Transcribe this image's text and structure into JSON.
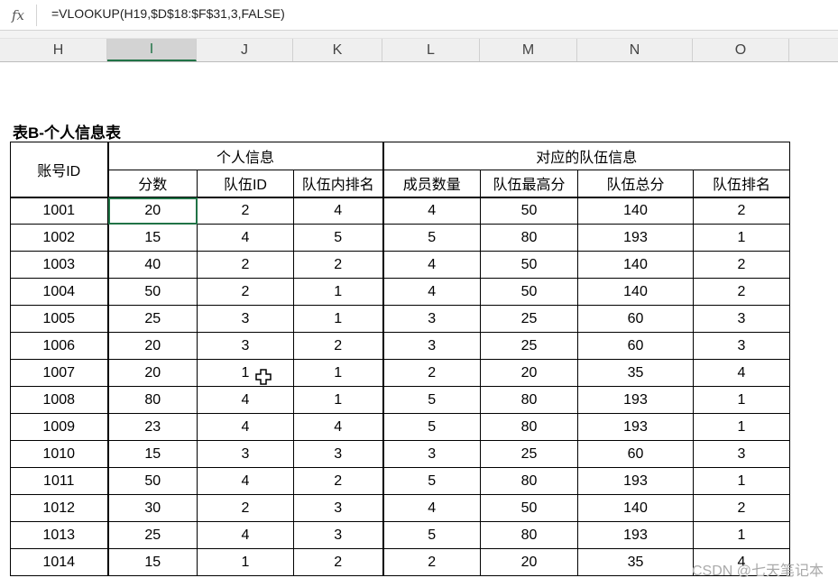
{
  "formula_bar": {
    "fx_label": "fx",
    "formula": "=VLOOKUP(H19,$D$18:$F$31,3,FALSE)"
  },
  "columns": [
    "H",
    "I",
    "J",
    "K",
    "L",
    "M",
    "N",
    "O"
  ],
  "selected_column": "I",
  "table": {
    "title": "表B-个人信息表",
    "group_headers": {
      "account": "账号ID",
      "personal": "个人信息",
      "team": "对应的队伍信息"
    },
    "sub_headers": [
      "分数",
      "队伍ID",
      "队伍内排名",
      "成员数量",
      "队伍最高分",
      "队伍总分",
      "队伍排名"
    ],
    "rows": [
      [
        "1001",
        "20",
        "2",
        "4",
        "4",
        "50",
        "140",
        "2"
      ],
      [
        "1002",
        "15",
        "4",
        "5",
        "5",
        "80",
        "193",
        "1"
      ],
      [
        "1003",
        "40",
        "2",
        "2",
        "4",
        "50",
        "140",
        "2"
      ],
      [
        "1004",
        "50",
        "2",
        "1",
        "4",
        "50",
        "140",
        "2"
      ],
      [
        "1005",
        "25",
        "3",
        "1",
        "3",
        "25",
        "60",
        "3"
      ],
      [
        "1006",
        "20",
        "3",
        "2",
        "3",
        "25",
        "60",
        "3"
      ],
      [
        "1007",
        "20",
        "1",
        "1",
        "2",
        "20",
        "35",
        "4"
      ],
      [
        "1008",
        "80",
        "4",
        "1",
        "5",
        "80",
        "193",
        "1"
      ],
      [
        "1009",
        "23",
        "4",
        "4",
        "5",
        "80",
        "193",
        "1"
      ],
      [
        "1010",
        "15",
        "3",
        "3",
        "3",
        "25",
        "60",
        "3"
      ],
      [
        "1011",
        "50",
        "4",
        "2",
        "5",
        "80",
        "193",
        "1"
      ],
      [
        "1012",
        "30",
        "2",
        "3",
        "4",
        "50",
        "140",
        "2"
      ],
      [
        "1013",
        "25",
        "4",
        "3",
        "5",
        "80",
        "193",
        "1"
      ],
      [
        "1014",
        "15",
        "1",
        "2",
        "2",
        "20",
        "35",
        "4"
      ]
    ]
  },
  "watermark": "CSDN @七天笔记本",
  "colors": {
    "accent": "#217346",
    "header_bg": "#efefef"
  }
}
